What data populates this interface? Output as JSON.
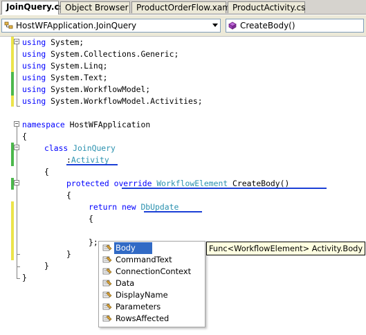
{
  "tabs": [
    {
      "label": "JoinQuery.cs*",
      "active": true
    },
    {
      "label": "Object Browser",
      "active": false
    },
    {
      "label": "ProductOrderFlow.xaml",
      "active": false
    },
    {
      "label": "ProductActivity.cs",
      "active": false
    }
  ],
  "navbar": {
    "type_combo": "HostWFApplication.JoinQuery",
    "member_combo": "CreateBody()"
  },
  "code": {
    "l1": {
      "kw": "using",
      "rest": " System;"
    },
    "l2": {
      "kw": "using",
      "rest": " System.Collections.Generic;"
    },
    "l3": {
      "kw": "using",
      "rest": " System.Linq;"
    },
    "l4": {
      "kw": "using",
      "rest": " System.Text;"
    },
    "l5": {
      "kw": "using",
      "rest": " System.WorkflowModel;"
    },
    "l6": {
      "kw": "using",
      "rest": " System.WorkflowModel.Activities;"
    },
    "l8": {
      "kw": "namespace",
      "rest": " HostWFApplication"
    },
    "l9": "{",
    "l10": {
      "kw": "class",
      "type": "JoinQuery"
    },
    "l11": {
      "colon": ":",
      "type": "Activity"
    },
    "l12": "{",
    "l13": {
      "kw1": "protected",
      "kw2": "override",
      "type": "WorkflowElement",
      "rest": " CreateBody()"
    },
    "l14": "{",
    "l15": {
      "kw1": "return",
      "kw2": "new",
      "type": "DbUpdate"
    },
    "l16": "{",
    "l18": "};",
    "l19": "}",
    "l20": "}",
    "l21": "}"
  },
  "intellisense": {
    "items": [
      "Body",
      "CommandText",
      "ConnectionContext",
      "Data",
      "DisplayName",
      "Parameters",
      "RowsAffected"
    ],
    "selected_index": 0,
    "tooltip": "Func<WorkflowElement> Activity.Body"
  },
  "colors": {
    "keyword": "#0000ff",
    "type": "#2b91af",
    "selection": "#316ac5",
    "change_yellow": "#ece44a",
    "change_green": "#4cb84c"
  }
}
